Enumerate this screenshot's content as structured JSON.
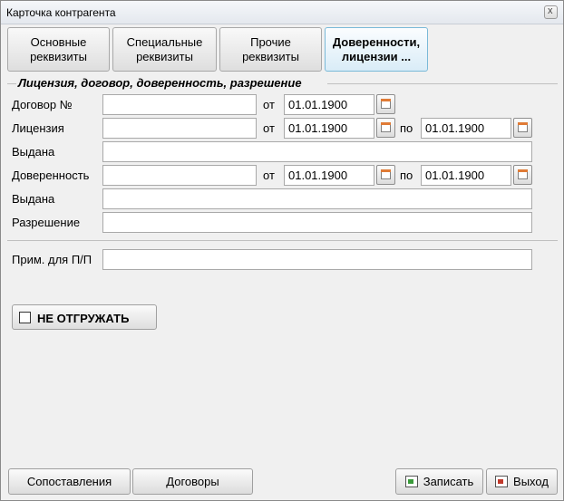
{
  "window": {
    "title": "Карточка контрагента",
    "close": "x"
  },
  "tabs": [
    {
      "label": "Основные\nреквизиты"
    },
    {
      "label": "Специальные\nреквизиты"
    },
    {
      "label": "Прочие\nреквизиты"
    },
    {
      "label": "Доверенности,\nлицензии ..."
    }
  ],
  "section": {
    "title": "Лицензия, договор, доверенность, разрешение"
  },
  "form": {
    "dogovor": {
      "label": "Договор №",
      "value": "",
      "ot_label": "от",
      "ot_date": "01.01.1900"
    },
    "licenziya": {
      "label": "Лицензия",
      "value": "",
      "ot_label": "от",
      "ot_date": "01.01.1900",
      "po_label": "по",
      "po_date": "01.01.1900"
    },
    "vydana1": {
      "label": "Выдана",
      "value": ""
    },
    "doverennost": {
      "label": "Доверенность",
      "value": "",
      "ot_label": "от",
      "ot_date": "01.01.1900",
      "po_label": "по",
      "po_date": "01.01.1900"
    },
    "vydana2": {
      "label": "Выдана",
      "value": ""
    },
    "razreshenie": {
      "label": "Разрешение",
      "value": ""
    },
    "prim": {
      "label": "Прим. для П/П",
      "value": ""
    }
  },
  "no_ship": {
    "label": "НЕ ОТГРУЖАТЬ",
    "checked": false
  },
  "buttons": {
    "sopostavleniya": "Сопоставления",
    "dogovory": "Договоры",
    "zapisat": "Записать",
    "vyhod": "Выход"
  }
}
